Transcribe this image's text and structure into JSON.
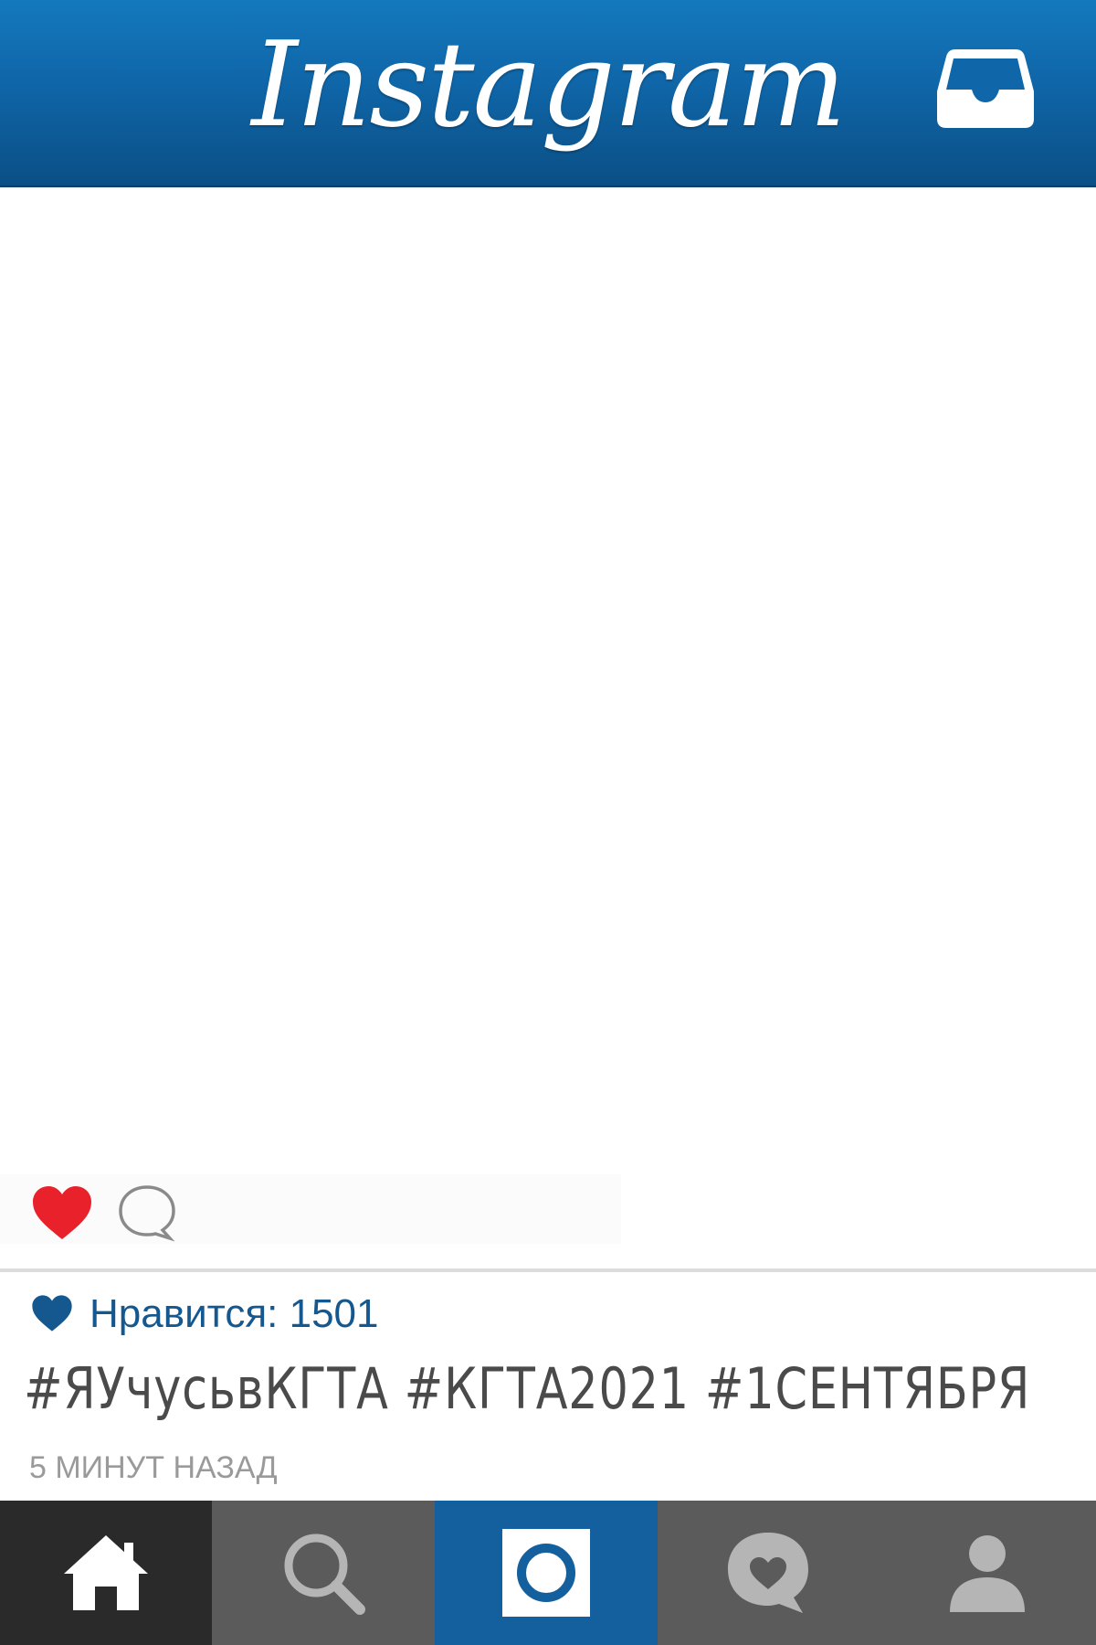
{
  "header": {
    "title": "Instagram",
    "inbox_icon": "inbox-tray-icon"
  },
  "post": {
    "like_icon": "heart-icon",
    "comment_icon": "comment-bubble-icon",
    "likes_text": "Нравится: 1501",
    "caption": "#ЯУчусьвКГТА #КГТА2021 #1СЕНТЯБРЯ",
    "timestamp": "5 МИНУТ НАЗАД"
  },
  "nav": {
    "items": [
      {
        "icon": "home-icon",
        "active": true
      },
      {
        "icon": "search-icon",
        "active": false
      },
      {
        "icon": "camera-icon",
        "active": false
      },
      {
        "icon": "activity-heart-bubble-icon",
        "active": false
      },
      {
        "icon": "profile-icon",
        "active": false
      }
    ]
  },
  "colors": {
    "header_blue": "#1479bd",
    "like_red": "#e8212a",
    "likes_text_blue": "#14588f",
    "caption_gray": "#4a4a4a",
    "timestamp_gray": "#9a9a9a",
    "nav_dark": "#2a2a2a",
    "nav_gray": "#5b5b5b",
    "nav_camera_blue": "#145f9e"
  }
}
